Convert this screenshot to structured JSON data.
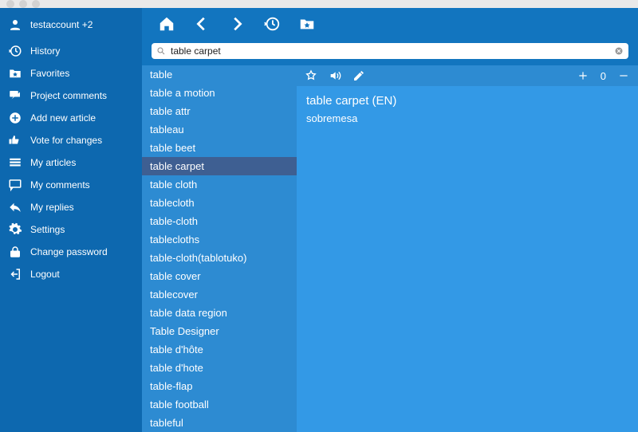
{
  "user": {
    "label": "testaccount  +2"
  },
  "sidebar": {
    "items": [
      {
        "label": "History"
      },
      {
        "label": "Favorites"
      },
      {
        "label": "Project comments"
      },
      {
        "label": "Add new article"
      },
      {
        "label": "Vote for changes"
      },
      {
        "label": "My articles"
      },
      {
        "label": "My comments"
      },
      {
        "label": "My replies"
      },
      {
        "label": "Settings"
      },
      {
        "label": "Change password"
      },
      {
        "label": "Logout"
      }
    ]
  },
  "search": {
    "value": "table carpet",
    "placeholder": ""
  },
  "toolbar_count": "0",
  "selected_index": 5,
  "results": [
    "table",
    "table a motion",
    "table attr",
    "tableau",
    "table beet",
    "table carpet",
    "table cloth",
    "tablecloth",
    "table-cloth",
    "tablecloths",
    "table-cloth(tablotuko)",
    "table cover",
    "tablecover",
    "table data region",
    "Table Designer",
    "table d'hôte",
    "table d'hote",
    "table-flap",
    "table football",
    "tableful"
  ],
  "detail": {
    "title": "table carpet (EN)",
    "translation": "sobremesa"
  }
}
